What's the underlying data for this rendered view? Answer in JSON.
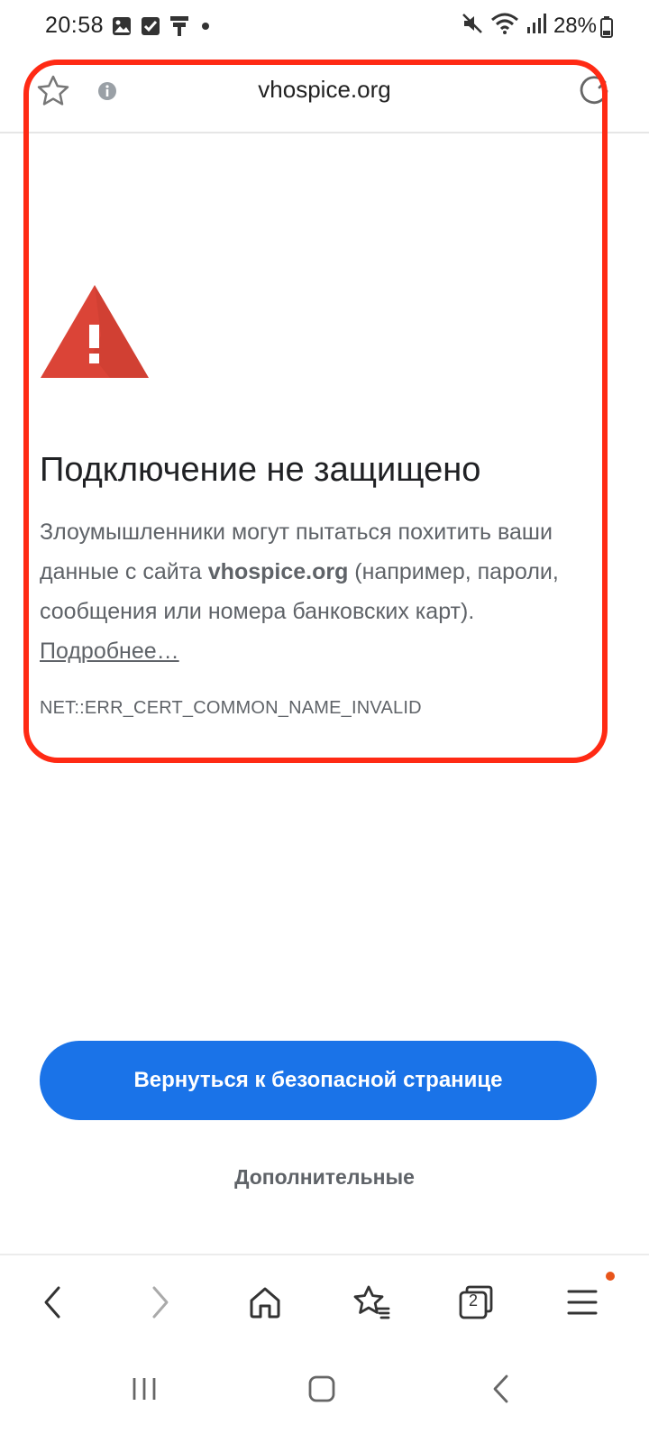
{
  "status_bar": {
    "time": "20:58",
    "battery_percent": "28%",
    "left_icons": [
      "gallery-icon",
      "checkbox-icon",
      "pin-icon",
      "dot-icon"
    ],
    "right_icons": [
      "mute-icon",
      "wifi-icon",
      "signal-icon",
      "battery-icon"
    ]
  },
  "url_bar": {
    "url": "vhospice.org"
  },
  "error": {
    "title": "Подключение не защищено",
    "body_before": "Злоумышленники могут пытаться похитить ваши данные с сайта ",
    "body_host": "vhospice.org",
    "body_after": " (например, пароли, сообщения или номера банковских карт).",
    "learn_more": "Подробнее…",
    "code": "NET::ERR_CERT_COMMON_NAME_INVALID"
  },
  "actions": {
    "back_to_safety": "Вернуться к безопасной странице",
    "advanced": "Дополнительные"
  },
  "toolbar": {
    "tab_count": "2"
  },
  "colors": {
    "primary": "#1a73e8",
    "warning": "#db4437",
    "highlight": "#ff2a14",
    "menu_badge": "#e8541a"
  }
}
